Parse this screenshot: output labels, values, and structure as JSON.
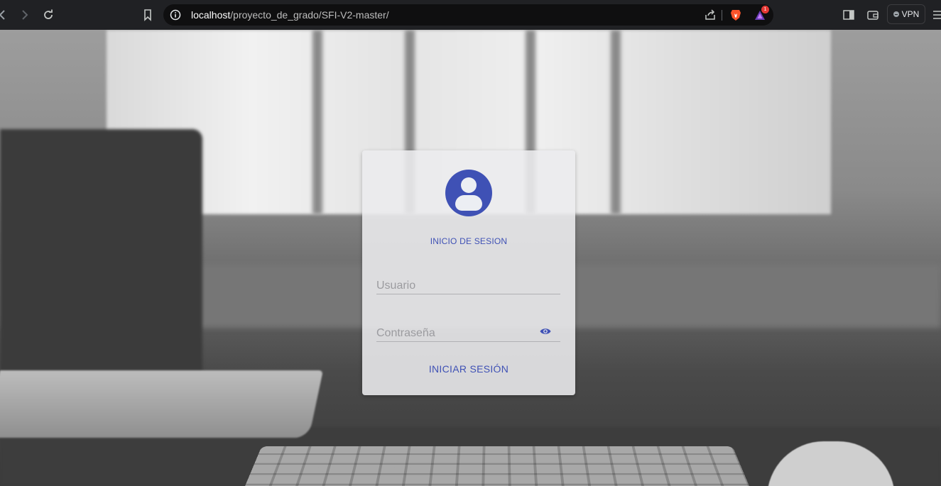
{
  "browser": {
    "url_host": "localhost",
    "url_path": "/proyecto_de_grado/SFI-V2-master/",
    "vpn_label": "VPN",
    "brave_badge_count": "1",
    "brand_color": "#fb542b"
  },
  "login": {
    "title": "INICIO DE SESION",
    "username_placeholder": "Usuario",
    "password_placeholder": "Contraseña",
    "submit_label": "INICIAR SESIÓN",
    "avatar_icon": "account-circle-icon",
    "accent_color": "#3f51b5"
  }
}
